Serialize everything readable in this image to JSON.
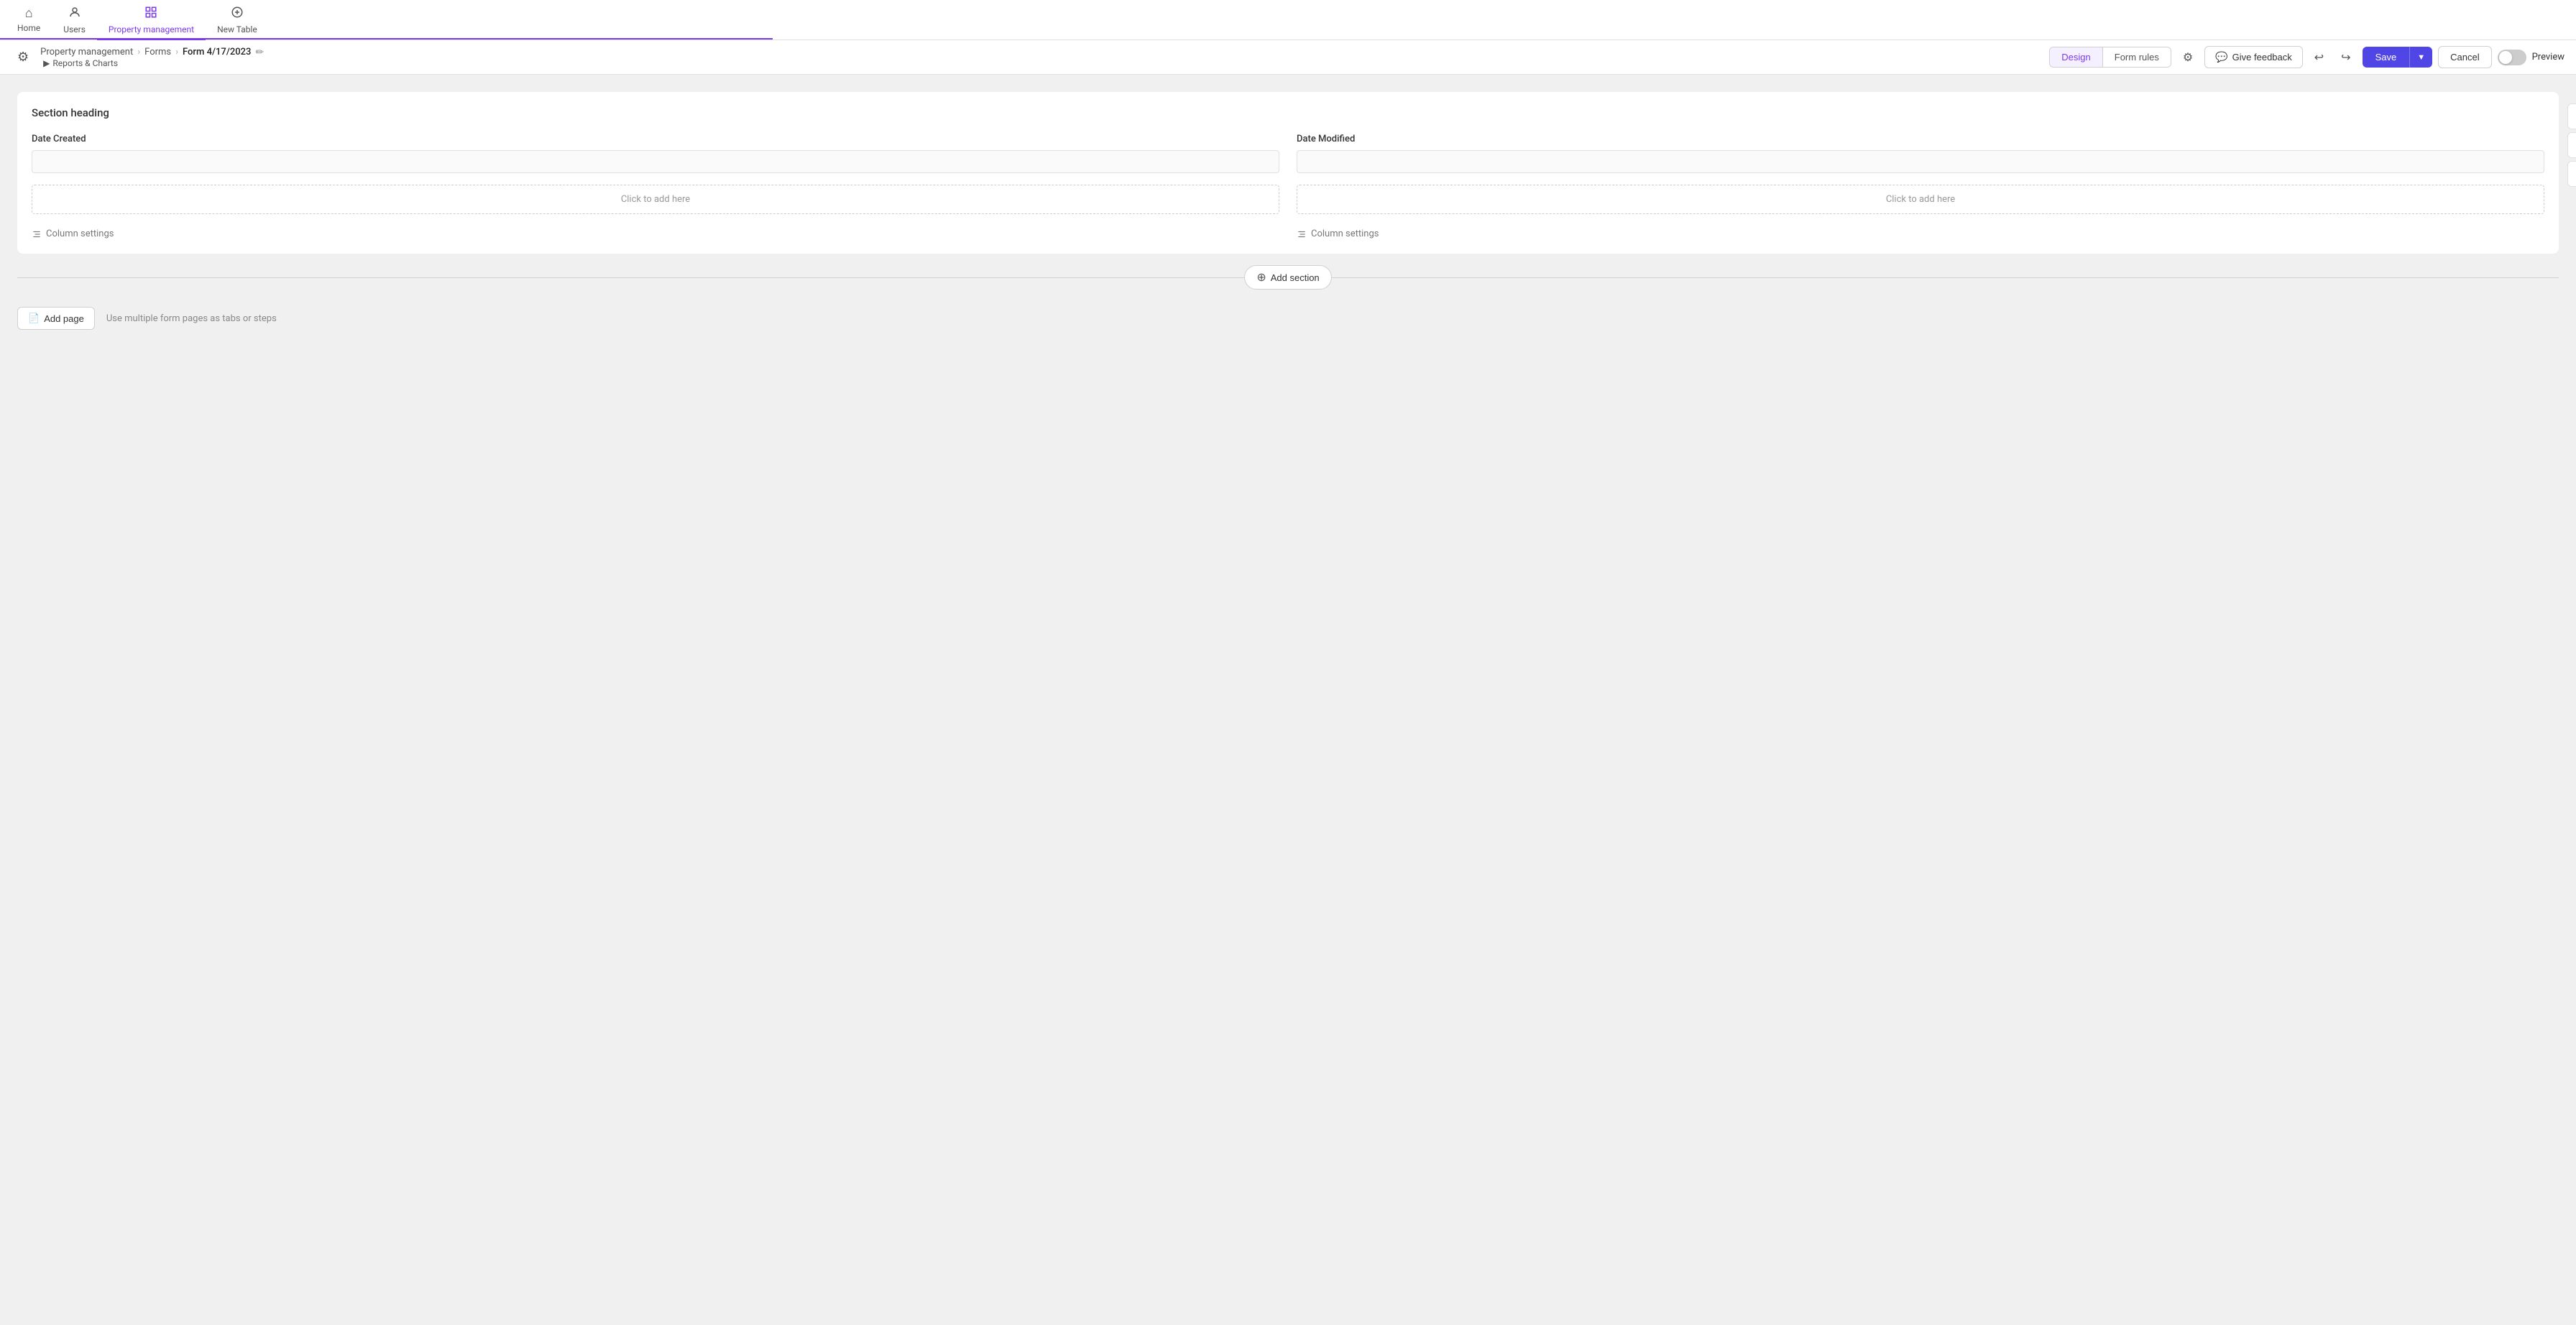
{
  "nav": {
    "items": [
      {
        "id": "home",
        "label": "Home",
        "icon": "⌂",
        "active": false
      },
      {
        "id": "users",
        "label": "Users",
        "icon": "👤",
        "active": false
      },
      {
        "id": "property-management",
        "label": "Property management",
        "icon": "⊞",
        "active": true
      },
      {
        "id": "new-table",
        "label": "New Table",
        "icon": "⊕",
        "active": false
      }
    ]
  },
  "toolbar": {
    "breadcrumb": {
      "root": "Property management",
      "sep1": ">",
      "middle": "Forms",
      "sep2": ">",
      "current": "Form 4/17/2023"
    },
    "reports_link": "Reports & Charts",
    "design_label": "Design",
    "form_rules_label": "Form rules",
    "feedback_label": "Give feedback",
    "save_label": "Save",
    "cancel_label": "Cancel",
    "preview_label": "Preview"
  },
  "form": {
    "section_heading": "Section heading",
    "left_column": {
      "field_label": "Date Created",
      "click_to_add": "Click to add here",
      "column_settings": "Column settings"
    },
    "right_column": {
      "field_label": "Date Modified",
      "click_to_add": "Click to add here",
      "column_settings": "Column settings"
    }
  },
  "add_section": {
    "label": "Add section"
  },
  "add_page": {
    "label": "Add page",
    "hint": "Use multiple form pages as tabs or steps"
  },
  "colors": {
    "accent": "#4f46e5",
    "accent_light": "#7c3aed",
    "delete": "#e53e3e"
  }
}
